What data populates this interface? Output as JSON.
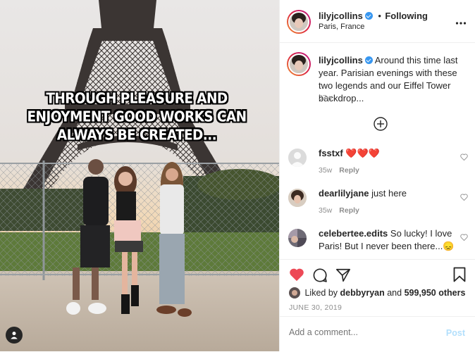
{
  "photo": {
    "caption": "THROUGH PLEASURE AND ENJOYMENT GOOD WORKS CAN ALWAYS BE CREATED..."
  },
  "header": {
    "username": "lilyjcollins",
    "separator": "•",
    "follow_status": "Following",
    "location": "Paris, France",
    "more_icon": "ellipsis-icon"
  },
  "post_caption": {
    "username": "lilyjcollins",
    "text": "Around this time last year. Parisian evenings with these two legends and our Eiffel Tower backdrop...",
    "age": "37w"
  },
  "load_more_icon": "plus-circle-icon",
  "comments": [
    {
      "username": "fsstxf",
      "text": "❤️❤️❤️",
      "age": "35w",
      "reply": "Reply"
    },
    {
      "username": "dearlilyjane",
      "text": "just here",
      "age": "35w",
      "reply": "Reply"
    },
    {
      "username": "celebertee.edits",
      "text": "So lucky! I love Paris! But I never been there...😞",
      "age": "",
      "reply": ""
    }
  ],
  "likes": {
    "prefix": "Liked by",
    "user": "debbyryan",
    "joiner": "and",
    "count": "599,950 others"
  },
  "date": "JUNE 30, 2019",
  "comment_box": {
    "placeholder": "Add a comment...",
    "post_label": "Post"
  },
  "colors": {
    "like_red": "#ed4956",
    "verified_blue": "#3897f0",
    "post_disabled": "#b2dffc"
  }
}
